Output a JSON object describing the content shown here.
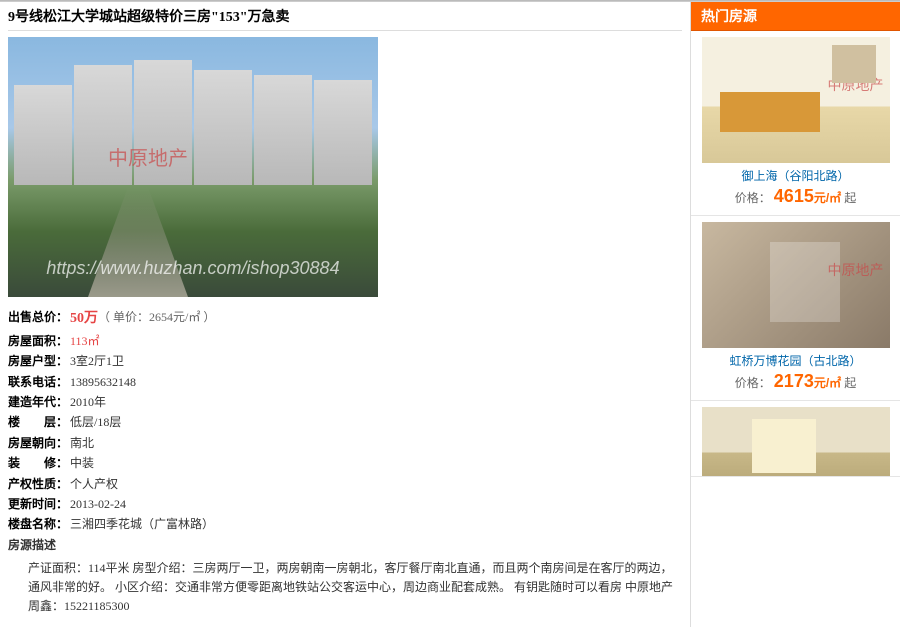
{
  "main": {
    "title": "9号线松江大学城站超级特价三房\"153\"万急卖",
    "photo": {
      "wm1": "中原地产",
      "wm2": "https://www.huzhan.com/ishop30884"
    },
    "specs": {
      "price_label": "出售总价：",
      "price": "50万",
      "unit_price": "（ 单价：2654元/㎡ ）",
      "area_label": "房屋面积：",
      "area": "113㎡",
      "layout_label": "房屋户型：",
      "layout": "3室2厅1卫",
      "phone_label": "联系电话：",
      "phone": "13895632148",
      "year_label": "建造年代：",
      "year": "2010年",
      "floor_label": "楼　　层：",
      "floor": "低层/18层",
      "orient_label": "房屋朝向：",
      "orient": "南北",
      "deco_label": "装　　修：",
      "deco": "中装",
      "rights_label": "产权性质：",
      "rights": "个人产权",
      "update_label": "更新时间：",
      "update": "2013-02-24",
      "estate_label": "楼盘名称：",
      "estate": "三湘四季花城（广富林路）",
      "desc_label": "房源描述",
      "desc": "产证面积：114平米 房型介绍：三房两厅一卫，两房朝南一房朝北，客厅餐厅南北直通，而且两个南房间是在客厅的两边，通风非常的好。 小区介绍：交通非常方便零距离地铁站公交客运中心，周边商业配套成熟。 有钥匙随时可以看房 中原地产 周鑫：15221185300"
    }
  },
  "side": {
    "header": "热门房源",
    "cards": [
      {
        "title": "御上海（谷阳北路）",
        "plabel": "价格：",
        "price": "4615",
        "unit": "元/㎡",
        "suffix": " 起",
        "wm": "中原地产"
      },
      {
        "title": "虹桥万博花园（古北路）",
        "plabel": "价格：",
        "price": "2173",
        "unit": "元/㎡",
        "suffix": " 起",
        "wm": "中原地产"
      },
      {
        "title": "",
        "plabel": "",
        "price": "",
        "unit": "",
        "suffix": "",
        "wm": ""
      }
    ]
  }
}
